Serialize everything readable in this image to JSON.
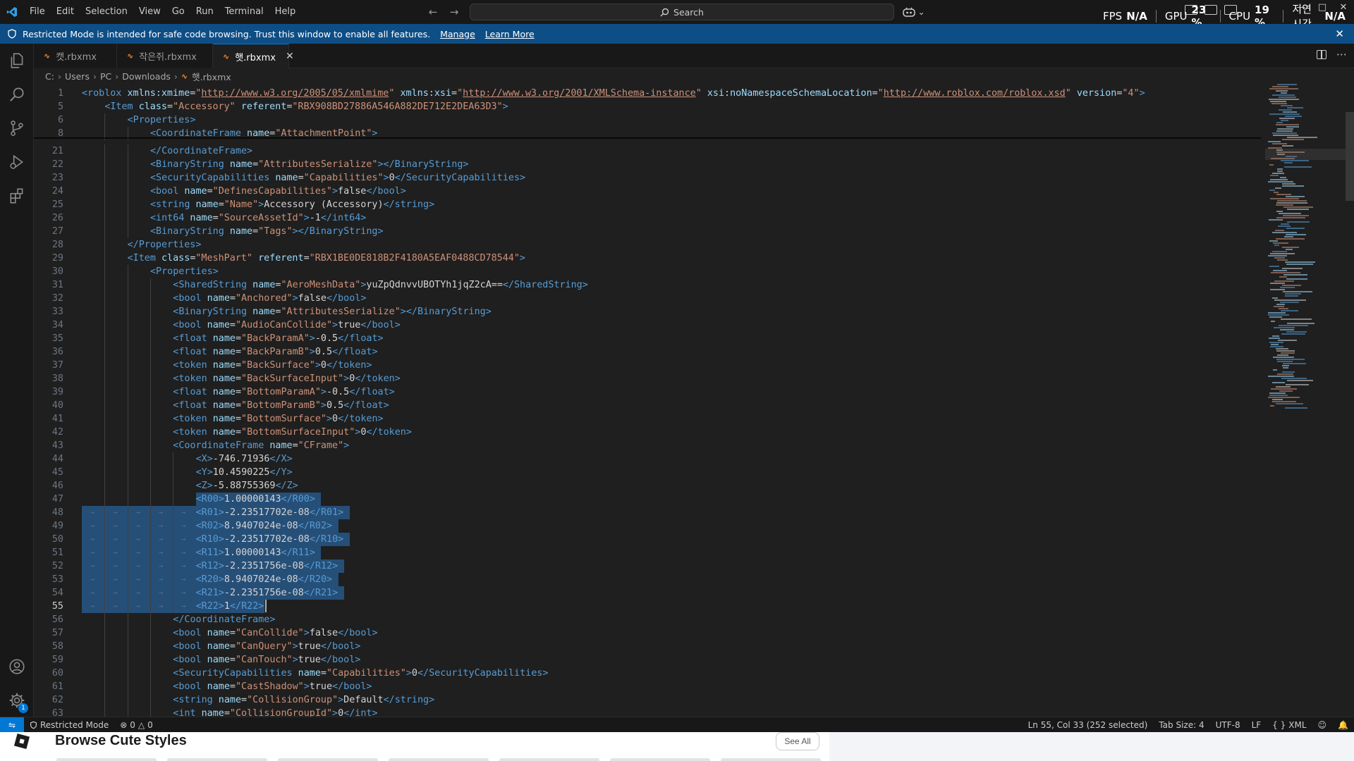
{
  "titlebar": {
    "menu": [
      "File",
      "Edit",
      "Selection",
      "View",
      "Go",
      "Run",
      "Terminal",
      "Help"
    ],
    "search_label": "Search"
  },
  "overlay": {
    "fps_label": "FPS",
    "fps_value": "N/A",
    "gpu_label": "GPU",
    "gpu_value": "23 %",
    "cpu_label": "CPU",
    "cpu_value": "19 %",
    "latency_label": "지연시간",
    "latency_value": "N/A"
  },
  "banner": {
    "message": "Restricted Mode is intended for safe code browsing. Trust this window to enable all features.",
    "manage": "Manage",
    "learn_more": "Learn More"
  },
  "tabs": [
    {
      "label": "캣.rbxmx",
      "active": false
    },
    {
      "label": "작은쥐.rbxmx",
      "active": false
    },
    {
      "label": "햇.rbxmx",
      "active": true
    }
  ],
  "breadcrumb": [
    "C:",
    "Users",
    "PC",
    "Downloads",
    "햇.rbxmx"
  ],
  "editor": {
    "current_line": 55,
    "lines": [
      {
        "n": 1,
        "indent": 0,
        "code": "<roblox xmlns:xmime=\"http://www.w3.org/2005/05/xmlmime\" xmlns:xsi=\"http://www.w3.org/2001/XMLSchema-instance\" xsi:noNamespaceSchemaLocation=\"http://www.roblox.com/roblox.xsd\" version=\"4\">"
      },
      {
        "n": 5,
        "indent": 1,
        "code": "<Item class=\"Accessory\" referent=\"RBX908BD27886A546A882DE712E2DEA63D3\">"
      },
      {
        "n": 6,
        "indent": 2,
        "code": "<Properties>"
      },
      {
        "n": 8,
        "indent": 3,
        "code": "<CoordinateFrame name=\"AttachmentPoint\">"
      },
      {
        "n": 21,
        "indent": 3,
        "code": "</CoordinateFrame>"
      },
      {
        "n": 22,
        "indent": 3,
        "code": "<BinaryString name=\"AttributesSerialize\"></BinaryString>"
      },
      {
        "n": 23,
        "indent": 3,
        "code": "<SecurityCapabilities name=\"Capabilities\">0</SecurityCapabilities>"
      },
      {
        "n": 24,
        "indent": 3,
        "code": "<bool name=\"DefinesCapabilities\">false</bool>"
      },
      {
        "n": 25,
        "indent": 3,
        "code": "<string name=\"Name\">Accessory (Accessory)</string>"
      },
      {
        "n": 26,
        "indent": 3,
        "code": "<int64 name=\"SourceAssetId\">-1</int64>"
      },
      {
        "n": 27,
        "indent": 3,
        "code": "<BinaryString name=\"Tags\"></BinaryString>"
      },
      {
        "n": 28,
        "indent": 2,
        "code": "</Properties>"
      },
      {
        "n": 29,
        "indent": 2,
        "code": "<Item class=\"MeshPart\" referent=\"RBX1BE0DE818B2F4180A5EAF0488CD78544\">"
      },
      {
        "n": 30,
        "indent": 3,
        "code": "<Properties>"
      },
      {
        "n": 31,
        "indent": 4,
        "code": "<SharedString name=\"AeroMeshData\">yuZpQdnvvUBOTYh1jqZ2cA==</SharedString>"
      },
      {
        "n": 32,
        "indent": 4,
        "code": "<bool name=\"Anchored\">false</bool>"
      },
      {
        "n": 33,
        "indent": 4,
        "code": "<BinaryString name=\"AttributesSerialize\"></BinaryString>"
      },
      {
        "n": 34,
        "indent": 4,
        "code": "<bool name=\"AudioCanCollide\">true</bool>"
      },
      {
        "n": 35,
        "indent": 4,
        "code": "<float name=\"BackParamA\">-0.5</float>"
      },
      {
        "n": 36,
        "indent": 4,
        "code": "<float name=\"BackParamB\">0.5</float>"
      },
      {
        "n": 37,
        "indent": 4,
        "code": "<token name=\"BackSurface\">0</token>"
      },
      {
        "n": 38,
        "indent": 4,
        "code": "<token name=\"BackSurfaceInput\">0</token>"
      },
      {
        "n": 39,
        "indent": 4,
        "code": "<float name=\"BottomParamA\">-0.5</float>"
      },
      {
        "n": 40,
        "indent": 4,
        "code": "<float name=\"BottomParamB\">0.5</float>"
      },
      {
        "n": 41,
        "indent": 4,
        "code": "<token name=\"BottomSurface\">0</token>"
      },
      {
        "n": 42,
        "indent": 4,
        "code": "<token name=\"BottomSurfaceInput\">0</token>"
      },
      {
        "n": 43,
        "indent": 4,
        "code": "<CoordinateFrame name=\"CFrame\">"
      },
      {
        "n": 44,
        "indent": 5,
        "code": "<X>-746.71936</X>"
      },
      {
        "n": 45,
        "indent": 5,
        "code": "<Y>10.4590225</Y>"
      },
      {
        "n": 46,
        "indent": 5,
        "code": "<Z>-5.88755369</Z>"
      },
      {
        "n": 47,
        "indent": 5,
        "code": "<R00>1.00000143</R00>",
        "sel": "partial"
      },
      {
        "n": 48,
        "indent": 5,
        "code": "<R01>-2.23517702e-08</R01>",
        "sel": "full"
      },
      {
        "n": 49,
        "indent": 5,
        "code": "<R02>8.9407024e-08</R02>",
        "sel": "full"
      },
      {
        "n": 50,
        "indent": 5,
        "code": "<R10>-2.23517702e-08</R10>",
        "sel": "full"
      },
      {
        "n": 51,
        "indent": 5,
        "code": "<R11>1.00000143</R11>",
        "sel": "full"
      },
      {
        "n": 52,
        "indent": 5,
        "code": "<R12>-2.2351756e-08</R12>",
        "sel": "full"
      },
      {
        "n": 53,
        "indent": 5,
        "code": "<R20>8.9407024e-08</R20>",
        "sel": "full"
      },
      {
        "n": 54,
        "indent": 5,
        "code": "<R21>-2.2351756e-08</R21>",
        "sel": "full"
      },
      {
        "n": 55,
        "indent": 5,
        "code": "<R22>1</R22>",
        "sel": "end"
      },
      {
        "n": 56,
        "indent": 4,
        "code": "</CoordinateFrame>"
      },
      {
        "n": 57,
        "indent": 4,
        "code": "<bool name=\"CanCollide\">false</bool>"
      },
      {
        "n": 58,
        "indent": 4,
        "code": "<bool name=\"CanQuery\">true</bool>"
      },
      {
        "n": 59,
        "indent": 4,
        "code": "<bool name=\"CanTouch\">true</bool>"
      },
      {
        "n": 60,
        "indent": 4,
        "code": "<SecurityCapabilities name=\"Capabilities\">0</SecurityCapabilities>"
      },
      {
        "n": 61,
        "indent": 4,
        "code": "<bool name=\"CastShadow\">true</bool>"
      },
      {
        "n": 62,
        "indent": 4,
        "code": "<string name=\"CollisionGroup\">Default</string>"
      },
      {
        "n": 63,
        "indent": 4,
        "code": "<int name=\"CollisionGroupId\">0</int>"
      }
    ]
  },
  "statusbar": {
    "restricted": "Restricted Mode",
    "errors": "0",
    "warnings": "0",
    "position": "Ln 55, Col 33 (252 selected)",
    "tab_size": "Tab Size: 4",
    "encoding": "UTF-8",
    "eol": "LF",
    "language": "XML",
    "settings_badge": "1"
  },
  "browser": {
    "title": "Browse Cute Styles",
    "see_all": "See All"
  },
  "colors": {
    "accent": "#0078d4",
    "banner": "#0e4e86",
    "selection": "#264f78",
    "tag": "#569cd6",
    "attribute": "#9cdcfe",
    "string": "#ce9178"
  }
}
